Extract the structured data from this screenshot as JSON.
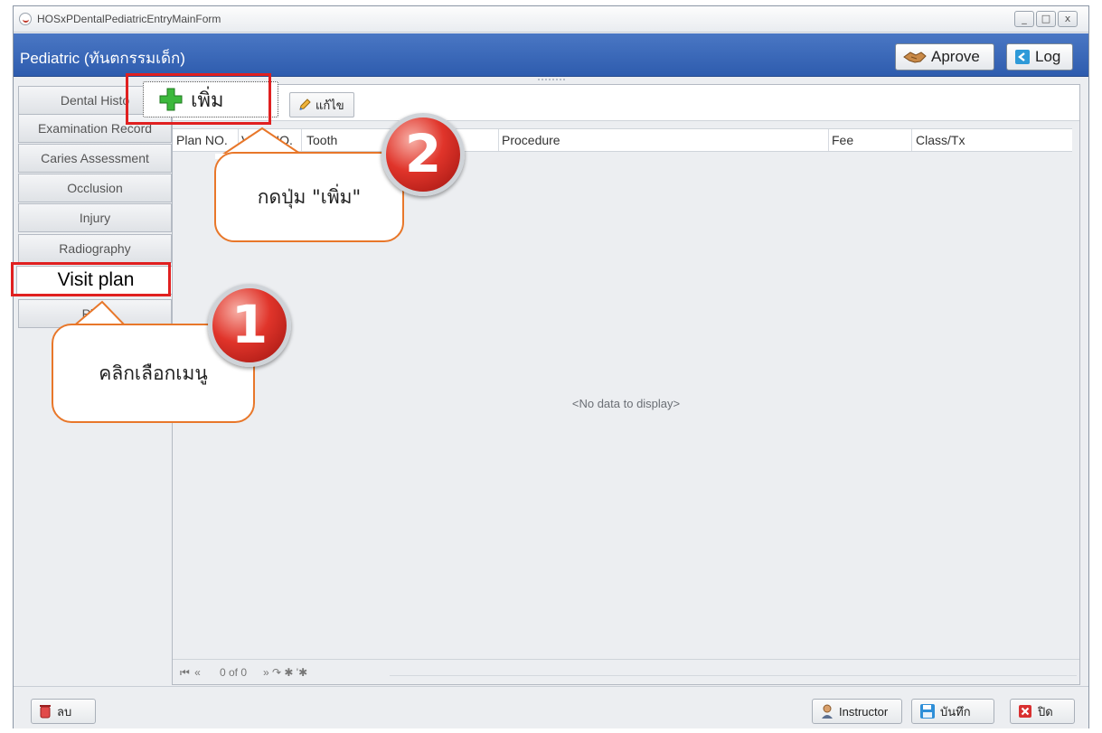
{
  "window": {
    "title": "HOSxPDentalPediatricEntryMainForm",
    "minimize": "_",
    "maximize": "□",
    "close": "x"
  },
  "header": {
    "title": "Pediatric (ทันตกรรมเด็ก)",
    "approve_label": "Aprove",
    "log_label": "Log"
  },
  "sidebar": {
    "items": [
      {
        "label": "Dental Histo"
      },
      {
        "label": "Examination Record"
      },
      {
        "label": "Caries Assessment"
      },
      {
        "label": "Occlusion"
      },
      {
        "label": "Injury"
      },
      {
        "label": "Radiography"
      },
      {
        "label": "Visit plan"
      },
      {
        "label": "Phot"
      }
    ]
  },
  "toolbar": {
    "add_label": "เพิ่ม",
    "edit_label": "แก้ไข"
  },
  "grid": {
    "columns": [
      "Plan NO.",
      "Visi",
      "NO.",
      "Tooth",
      "Procedure",
      "Fee",
      "Class/Tx"
    ],
    "empty_text": "<No data to display>"
  },
  "pager": {
    "text": "0 of 0"
  },
  "footer": {
    "delete_label": "ลบ",
    "instructor_label": "Instructor",
    "save_label": "บันทึก",
    "close_label": "ปิด"
  },
  "annotations": {
    "step1_number": "1",
    "step1_text": "คลิกเลือกเมนู",
    "step2_number": "2",
    "step2_text": "กดปุ่ม \"เพิ่ม\""
  },
  "colors": {
    "header_blue": "#3563b4",
    "highlight_red": "#e02020",
    "callout_orange": "#e8772a",
    "badge_red": "#e0342a"
  }
}
